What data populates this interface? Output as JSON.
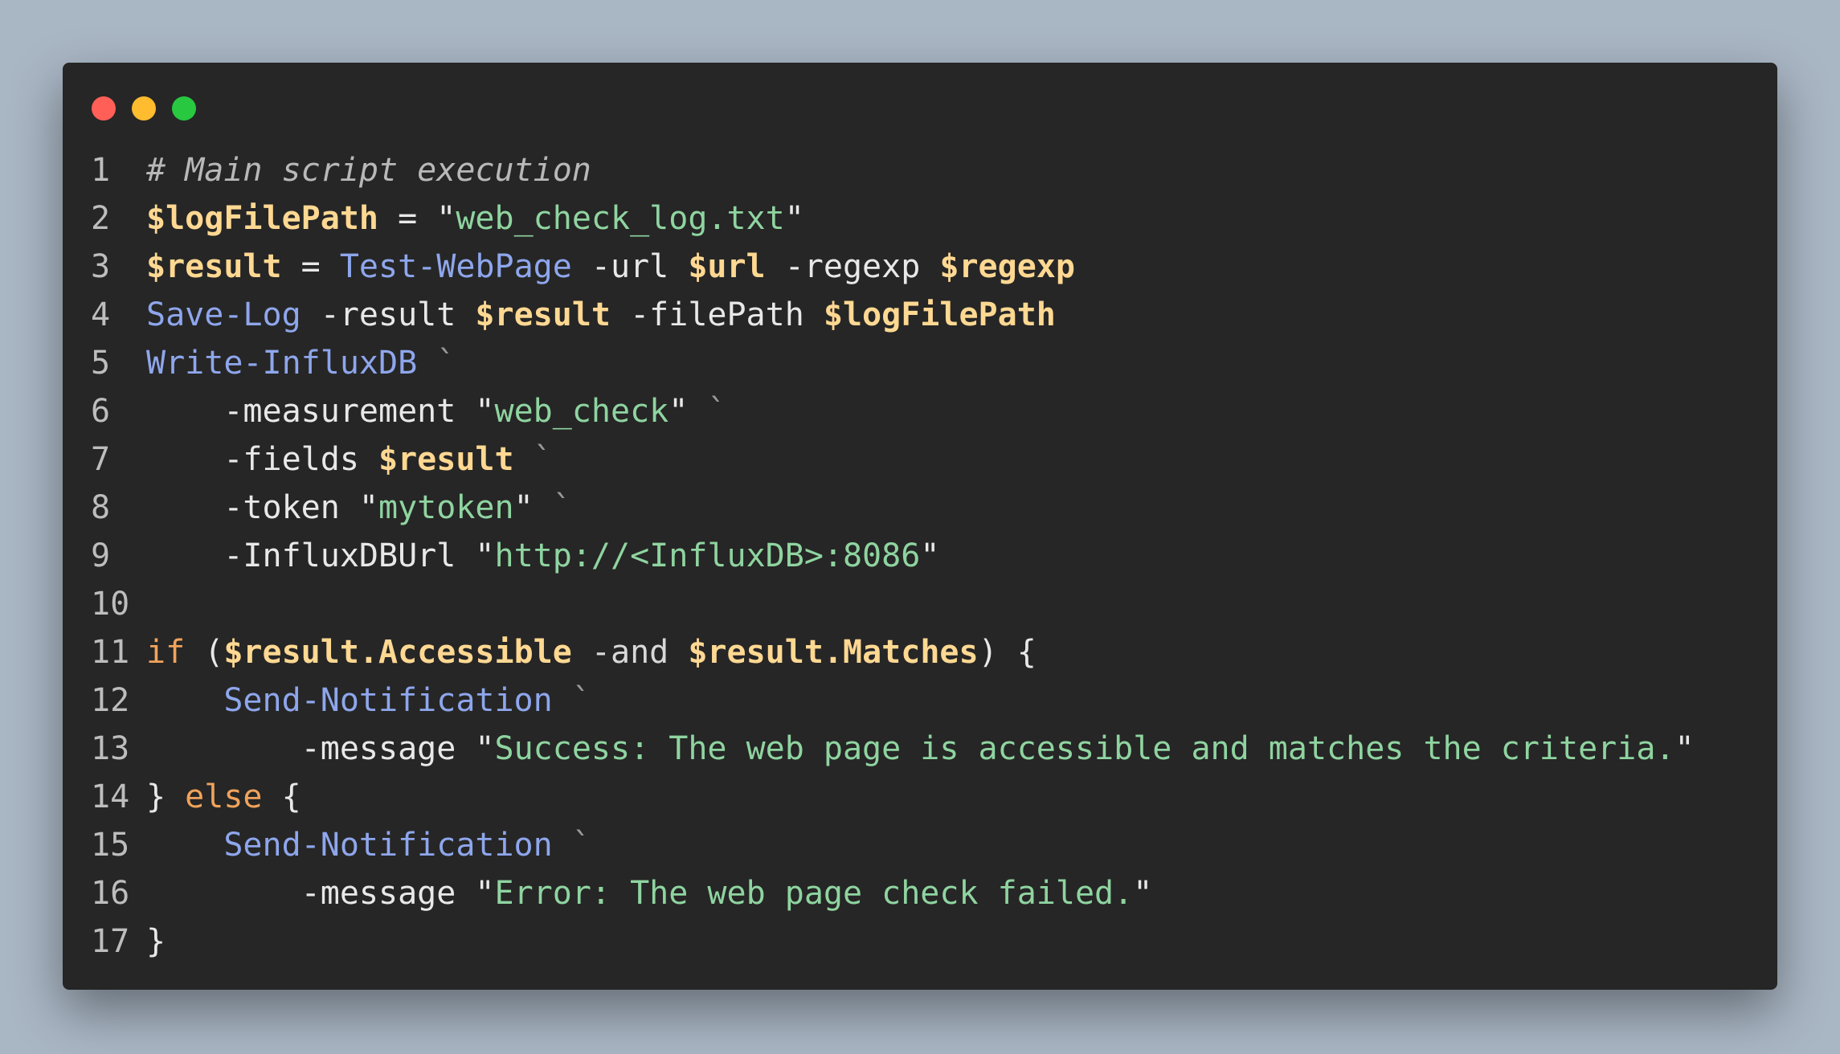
{
  "window": {
    "controls": [
      {
        "name": "close",
        "color": "#ff5f57"
      },
      {
        "name": "minimize",
        "color": "#febc2e"
      },
      {
        "name": "maximize",
        "color": "#28c840"
      }
    ]
  },
  "code": {
    "language": "powershell",
    "lines": [
      {
        "num": "1",
        "tokens": [
          {
            "t": "# Main script execution",
            "k": "comment"
          }
        ]
      },
      {
        "num": "2",
        "tokens": [
          {
            "t": "$logFilePath",
            "k": "var"
          },
          {
            "t": " = ",
            "k": "plain"
          },
          {
            "t": "\"",
            "k": "plain"
          },
          {
            "t": "web_check_log.txt",
            "k": "str"
          },
          {
            "t": "\"",
            "k": "plain"
          }
        ]
      },
      {
        "num": "3",
        "tokens": [
          {
            "t": "$result",
            "k": "var"
          },
          {
            "t": " = ",
            "k": "plain"
          },
          {
            "t": "Test-WebPage",
            "k": "cmd"
          },
          {
            "t": " -url ",
            "k": "plain"
          },
          {
            "t": "$url",
            "k": "var"
          },
          {
            "t": " -regexp ",
            "k": "plain"
          },
          {
            "t": "$regexp",
            "k": "var"
          }
        ]
      },
      {
        "num": "4",
        "tokens": [
          {
            "t": "Save-Log",
            "k": "cmd"
          },
          {
            "t": " -result ",
            "k": "plain"
          },
          {
            "t": "$result",
            "k": "var"
          },
          {
            "t": " -filePath ",
            "k": "plain"
          },
          {
            "t": "$logFilePath",
            "k": "var"
          }
        ]
      },
      {
        "num": "5",
        "tokens": [
          {
            "t": "Write-InfluxDB",
            "k": "cmd"
          },
          {
            "t": " `",
            "k": "tick"
          }
        ]
      },
      {
        "num": "6",
        "tokens": [
          {
            "t": "    -measurement ",
            "k": "plain"
          },
          {
            "t": "\"",
            "k": "plain"
          },
          {
            "t": "web_check",
            "k": "str"
          },
          {
            "t": "\"",
            "k": "plain"
          },
          {
            "t": " `",
            "k": "tick"
          }
        ]
      },
      {
        "num": "7",
        "tokens": [
          {
            "t": "    -fields ",
            "k": "plain"
          },
          {
            "t": "$result",
            "k": "var"
          },
          {
            "t": " `",
            "k": "tick"
          }
        ]
      },
      {
        "num": "8",
        "tokens": [
          {
            "t": "    -token ",
            "k": "plain"
          },
          {
            "t": "\"",
            "k": "plain"
          },
          {
            "t": "mytoken",
            "k": "str"
          },
          {
            "t": "\"",
            "k": "plain"
          },
          {
            "t": " `",
            "k": "tick"
          }
        ]
      },
      {
        "num": "9",
        "tokens": [
          {
            "t": "    -InfluxDBUrl ",
            "k": "plain"
          },
          {
            "t": "\"",
            "k": "plain"
          },
          {
            "t": "http://<InfluxDB>:8086",
            "k": "str"
          },
          {
            "t": "\"",
            "k": "plain"
          }
        ]
      },
      {
        "num": "10",
        "tokens": []
      },
      {
        "num": "11",
        "tokens": [
          {
            "t": "if",
            "k": "kw"
          },
          {
            "t": " (",
            "k": "plain"
          },
          {
            "t": "$result.Accessible",
            "k": "var"
          },
          {
            "t": " -and ",
            "k": "op"
          },
          {
            "t": "$result.Matches",
            "k": "var"
          },
          {
            "t": ") {",
            "k": "plain"
          }
        ]
      },
      {
        "num": "12",
        "tokens": [
          {
            "t": "    ",
            "k": "plain"
          },
          {
            "t": "Send-Notification",
            "k": "cmd"
          },
          {
            "t": " `",
            "k": "tick"
          }
        ]
      },
      {
        "num": "13",
        "tokens": [
          {
            "t": "        -message ",
            "k": "plain"
          },
          {
            "t": "\"",
            "k": "plain"
          },
          {
            "t": "Success: The web page is accessible and matches the criteria.",
            "k": "str"
          },
          {
            "t": "\"",
            "k": "plain"
          }
        ]
      },
      {
        "num": "14",
        "tokens": [
          {
            "t": "} ",
            "k": "plain"
          },
          {
            "t": "else",
            "k": "kw"
          },
          {
            "t": " {",
            "k": "plain"
          }
        ]
      },
      {
        "num": "15",
        "tokens": [
          {
            "t": "    ",
            "k": "plain"
          },
          {
            "t": "Send-Notification",
            "k": "cmd"
          },
          {
            "t": " `",
            "k": "tick"
          }
        ]
      },
      {
        "num": "16",
        "tokens": [
          {
            "t": "        -message ",
            "k": "plain"
          },
          {
            "t": "\"",
            "k": "plain"
          },
          {
            "t": "Error: The web page check failed.",
            "k": "str"
          },
          {
            "t": "\"",
            "k": "plain"
          }
        ]
      },
      {
        "num": "17",
        "tokens": [
          {
            "t": "}",
            "k": "plain"
          }
        ]
      }
    ]
  }
}
